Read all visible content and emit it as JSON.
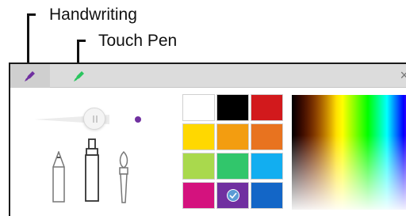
{
  "callouts": {
    "handwriting": "Handwriting",
    "touch_pen": "Touch Pen"
  },
  "tabs": [
    {
      "name": "handwriting",
      "icon": "pen-icon",
      "color": "#7030a0",
      "active": true
    },
    {
      "name": "touch_pen",
      "icon": "pen-icon",
      "color": "#2bc55f",
      "active": false
    }
  ],
  "close_glyph": "×",
  "pen_settings": {
    "thickness": 0.8,
    "preview_color": "#7030a0",
    "tools": [
      "pencil-icon",
      "marker-icon",
      "brush-icon"
    ],
    "selected_tool": "marker-icon"
  },
  "palette": {
    "colors": [
      "#ffffff",
      "#000000",
      "#d2191c",
      "#ffd800",
      "#f39d10",
      "#e8731f",
      "#a9d94d",
      "#31c66b",
      "#12aef0",
      "#d4127e",
      "#7030a0",
      "#1366c7"
    ],
    "selected_index": 10
  }
}
